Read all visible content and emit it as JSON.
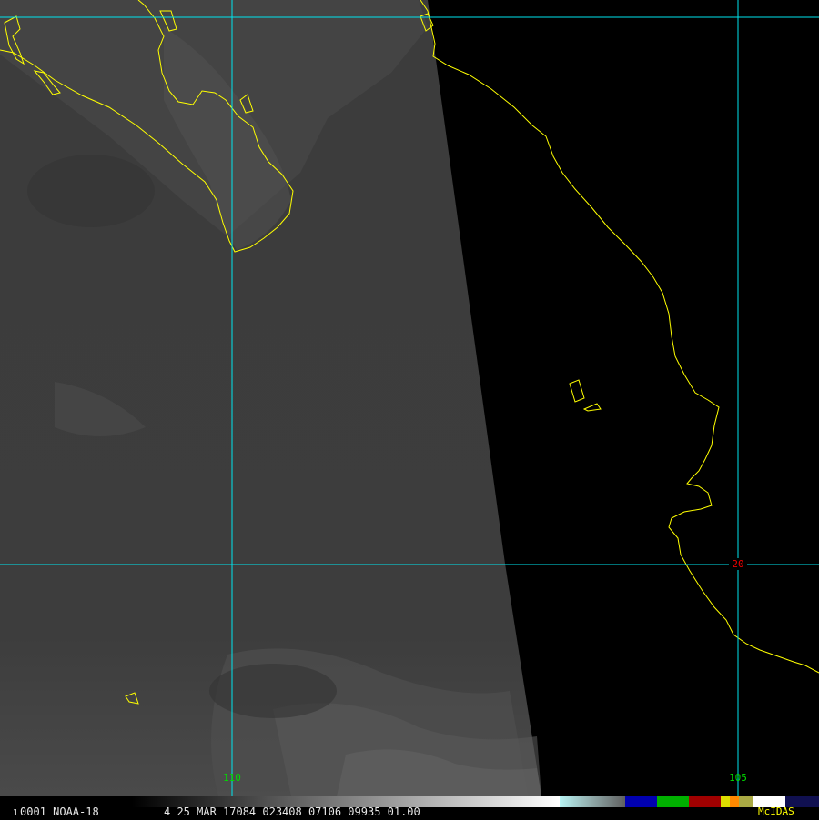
{
  "map": {
    "labels": {
      "lon_110": "110",
      "lon_105": "105",
      "lat_20": "20"
    },
    "colors": {
      "coastline": "#ffff00",
      "gridline": "#00e5ee",
      "lon_label": "#00dd00",
      "lat_label": "#ee0000",
      "no_data": "#000000"
    }
  },
  "status": {
    "frame": "1",
    "image_id": "0001 NOAA-18",
    "datetime": "4 25 MAR 17084 023408 07106 09935 01.00",
    "brand": "McIDAS"
  },
  "colors": {
    "brand": "#ffff00",
    "status_text": "#e8e8e8"
  }
}
